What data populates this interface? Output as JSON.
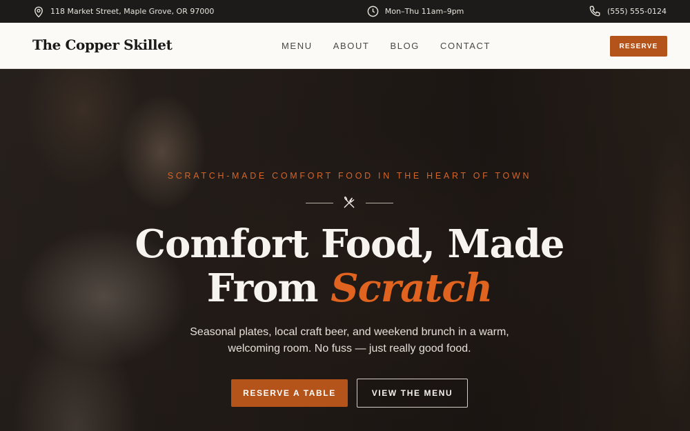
{
  "topbar": {
    "address": "118 Market Street, Maple Grove, OR 97000",
    "hours": "Mon–Thu 11am–9pm",
    "phone": "(555) 555-0124",
    "icons": [
      "map-pin-icon",
      "clock-icon",
      "phone-icon"
    ]
  },
  "nav": {
    "brand": "The Copper Skillet",
    "links": [
      "MENU",
      "ABOUT",
      "BLOG",
      "CONTACT"
    ],
    "reserve_label": "RESERVE"
  },
  "hero": {
    "eyebrow": "SCRATCH-MADE COMFORT FOOD IN THE HEART OF TOWN",
    "divider_icon": "fork-knife-icon",
    "headline_line1": "Comfort Food, Made",
    "headline_line2_plain": "From ",
    "headline_line2_accent": "Scratch",
    "subtext_line1": "Seasonal plates, local craft beer, and weekend brunch in a warm,",
    "subtext_line2": "welcoming room. No fuss — just really good food.",
    "cta_primary": "RESERVE A TABLE",
    "cta_secondary": "VIEW THE MENU"
  },
  "colors": {
    "accent": "#b5541a",
    "headline_accent": "#e0641f",
    "topbar_bg": "#1d1b19",
    "nav_bg": "#fbfaf7"
  }
}
